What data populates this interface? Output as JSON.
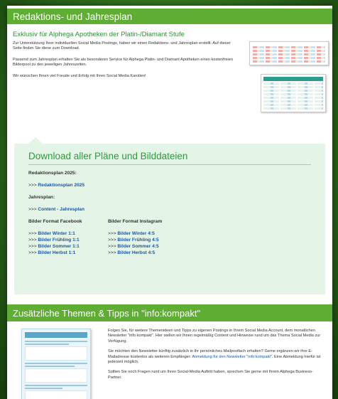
{
  "header": {
    "title": "Redaktions- und Jahresplan"
  },
  "intro": {
    "subtitle": "Exklusiv für Alphega Apotheken der Platin-/Diamant Stufe",
    "p1": "Zur Unterstützung Ihrer individuellen Social Media Postings, haben wir einen Redaktions- und Jahresplan erstellt. Auf dieser Seite finden Sie diese zum Download.",
    "p2": "Passend zum Jahresplan erhalten Sie als besonderen Service für Alphega Platin- und Diamant Apotheken einen kostenfreien Bilderpool zu den jeweiligen Jahreszeiten.",
    "p3": "Wir wünschen Ihnen viel Freude und Erfolg mit Ihren Social Media Kanälen!"
  },
  "download": {
    "title": "Download aller Pläne und Bilddateien",
    "redaktionsplan_label": "Redaktionsplan 2025:",
    "redaktionsplan_link": "Redaktionsplan 2025",
    "jahresplan_label": "Jahresplan:",
    "jahresplan_link": "Content - Jahresplan",
    "arrows": ">>>",
    "facebook": {
      "label": "Bilder Format Facebook",
      "links": [
        "Bilder Winter 1:1",
        "Bilder Frühling 1:1",
        "Bilder Sommer 1:1",
        "Bilder Herbst 1:1"
      ]
    },
    "instagram": {
      "label": "Bilder Format Instagram",
      "links": [
        "Bilder Winter 4:5",
        "Bilder Frühling 4:5",
        "Bilder Sommer 4:5",
        "Bilder Herbst 4:5"
      ]
    }
  },
  "tips": {
    "title": "Zusätzliche Themen & Tipps in \"info:kompakt\"",
    "p1": "Folgen Sie, für weitere Themenideen und Tipps zu eigenen Postings in Ihrem Social Media Account, dem monatlichen Newsletter \"info kompakt\". Hier stellen wir Ihnen regelmäßig Content und Hinweise rund um das Thema Social Media zur Verfügung.",
    "p2_start": "Sie möchten den Newsletter künftig zusätzlich in Ihr persönliches Mailpostfach erhalten? Gerne ergänzen wir Ihre E-Mailadresse kostenlos als weiteren Empfänger:",
    "p2_link": "Anmeldung für den Newsletter \"info:kompakt\"",
    "p2_end": ". Eine Abmeldung hierfür ist jederzeit möglich.",
    "p3": "Sollten Sie noch Fragen rund um Ihren Social-Media Auftritt haben, sprechen Sie gerne mit Ihrem Alphega Business-Partner."
  }
}
